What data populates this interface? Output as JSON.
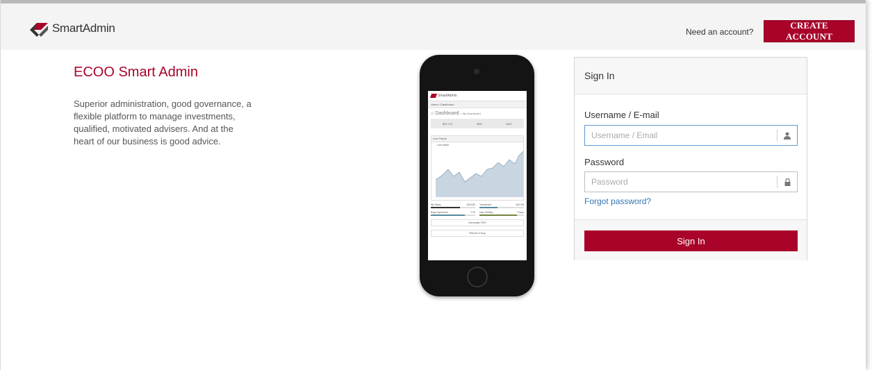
{
  "header": {
    "brand": "SmartAdmin",
    "need_account": "Need an account?",
    "create_account": "Create Account"
  },
  "hero": {
    "title": "ECOO Smart Admin",
    "description": "Superior administration, good governance, a flexible platform to manage investments, qualified, motivated advisers. And at the heart of our business is good advice."
  },
  "phone": {
    "brand": "SmartAdmin",
    "breadcrumb": "Home / Dashboard",
    "dashboard": "Dashboard",
    "dashboard_sub": "> My Dashboard",
    "stats": [
      "$47,171",
      "45%",
      "2447"
    ],
    "feed_title": "Live Feeds",
    "live_switch": "Live switch",
    "tasks": [
      {
        "label": "My Tasks",
        "value": "130/200",
        "color": "#333333",
        "fill": 0.65
      },
      {
        "label": "Transfered",
        "value": "440 GB",
        "color": "#57889c",
        "fill": 0.4
      },
      {
        "label": "Bugs Squashed",
        "value": "77%",
        "color": "#57889c",
        "fill": 0.77
      },
      {
        "label": "User Testing",
        "value": "7 Days",
        "color": "#71843f",
        "fill": 0.85
      }
    ],
    "generate_pdf": "Generate PDF",
    "report_bug": "Report a bug"
  },
  "signin": {
    "title": "Sign In",
    "username_label": "Username / E-mail",
    "username_placeholder": "Username / Email",
    "password_label": "Password",
    "password_placeholder": "Password",
    "forgot": "Forgot password?",
    "button": "Sign In"
  },
  "colors": {
    "brand": "#a90329",
    "link": "#3276b1",
    "focus": "#5d98cc"
  },
  "icons": {
    "logo": "smartadmin-logo-icon",
    "user": "user-icon",
    "lock": "lock-icon"
  }
}
